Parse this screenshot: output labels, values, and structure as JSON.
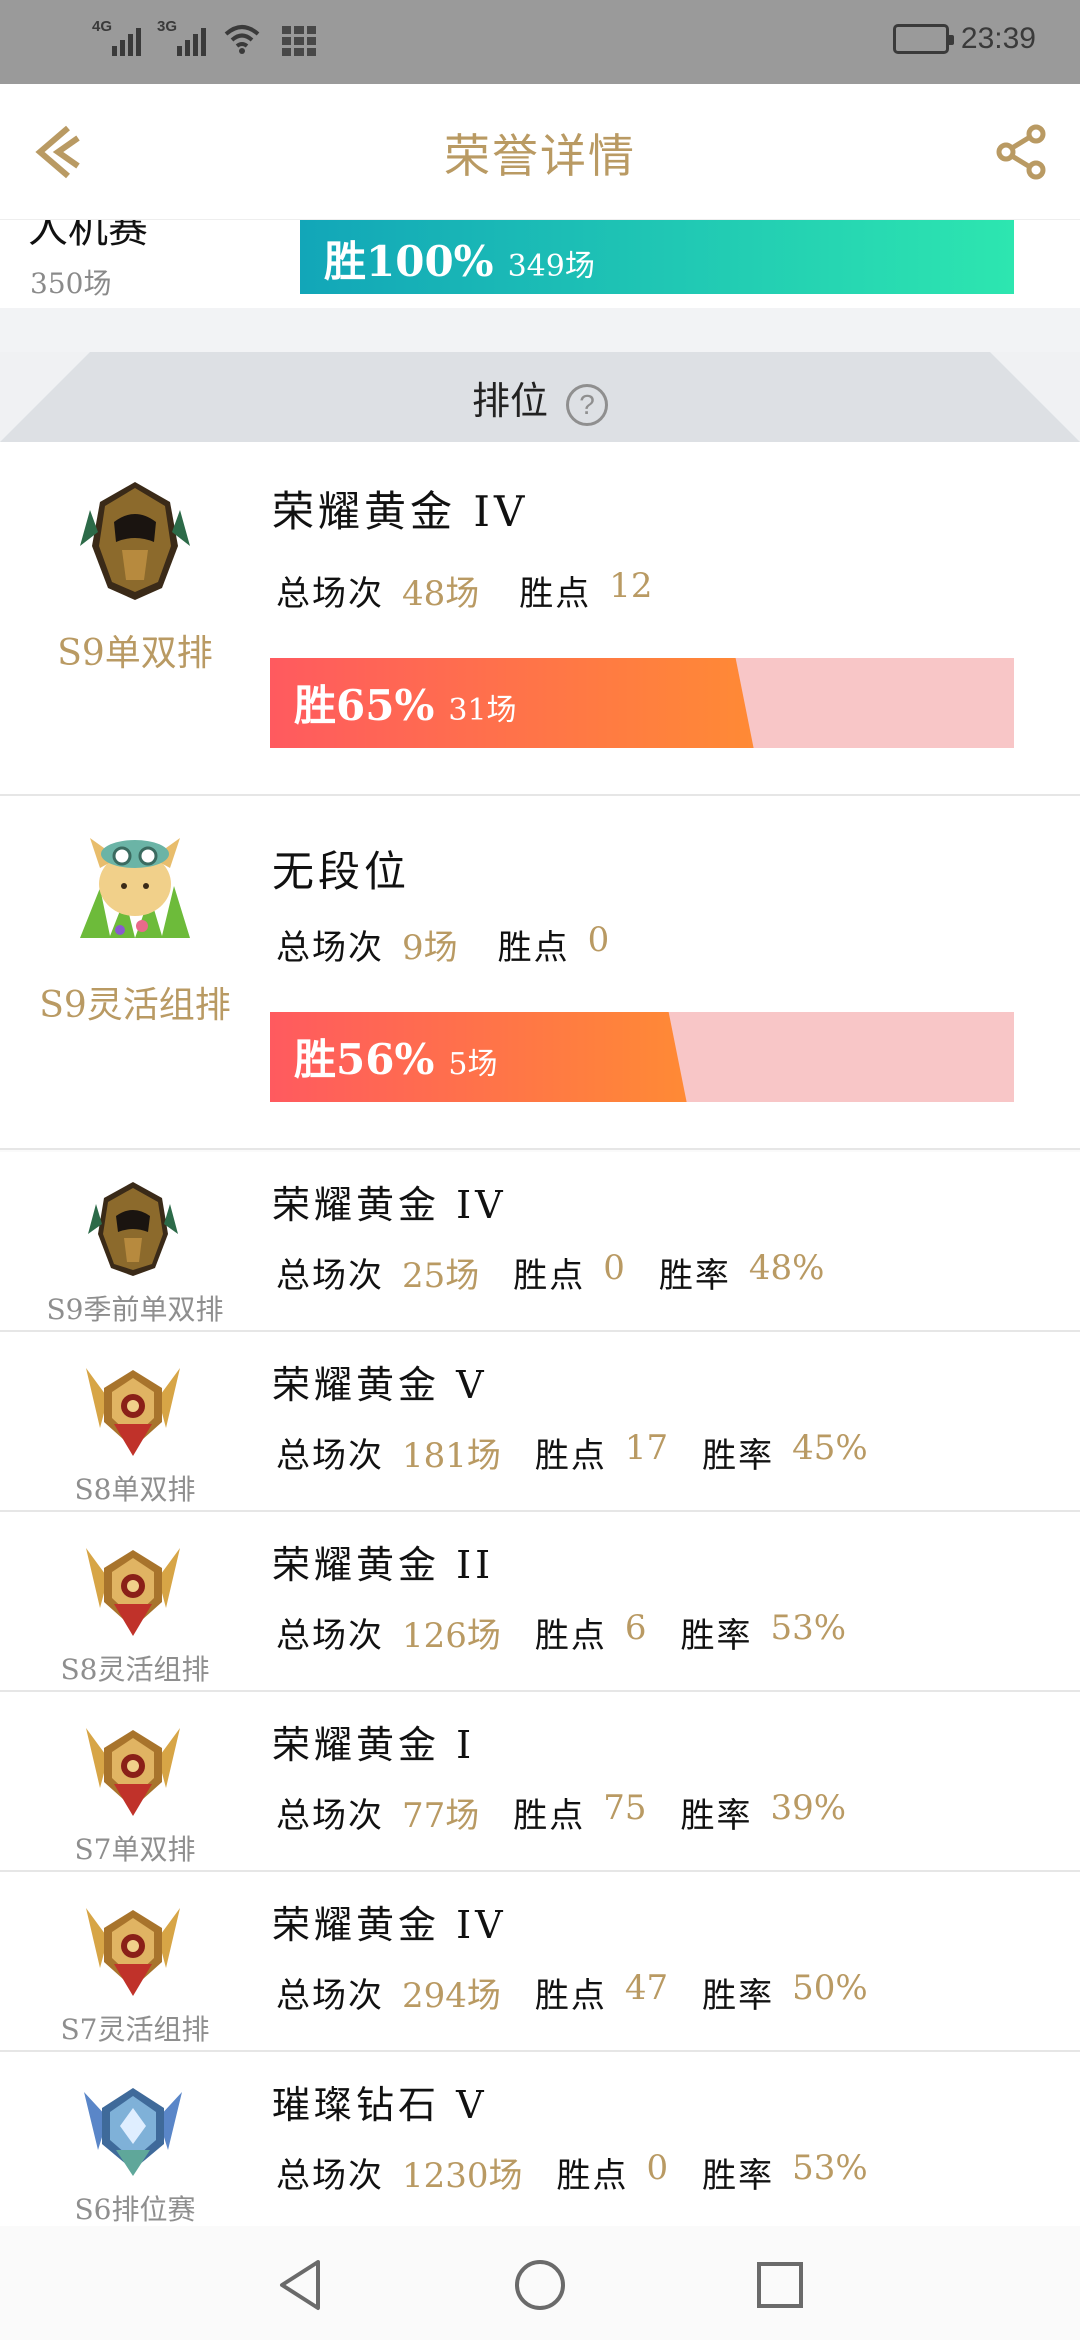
{
  "status_bar": {
    "signal1_label": "4G",
    "signal2_label": "3G",
    "time": "23:39"
  },
  "header": {
    "title": "荣誉详情"
  },
  "top_partial": {
    "name": "人机赛",
    "count": "350场",
    "win_label": "胜100%",
    "win_games": "349场",
    "win_rate": 1.0
  },
  "section": {
    "title": "排位",
    "help_glyph": "?"
  },
  "labels": {
    "total": "总场次",
    "points": "胜点",
    "rate": "胜率"
  },
  "big_entries": [
    {
      "season": "S9单双排",
      "rank": "荣耀黄金 IV",
      "total": "48场",
      "points": "12",
      "win_label": "胜65%",
      "win_games": "31场",
      "win_rate": 0.65,
      "icon": "gold-helmet-icon"
    },
    {
      "season": "S9灵活组排",
      "rank": "无段位",
      "total": "9场",
      "points": "0",
      "win_label": "胜56%",
      "win_games": "5场",
      "win_rate": 0.56,
      "icon": "teemo-avatar-icon"
    }
  ],
  "small_entries": [
    {
      "season": "S9季前单双排",
      "rank": "荣耀黄金 IV",
      "total": "25场",
      "points": "0",
      "rate": "48%",
      "icon": "gold-helmet-icon"
    },
    {
      "season": "S8单双排",
      "rank": "荣耀黄金 V",
      "total": "181场",
      "points": "17",
      "rate": "45%",
      "icon": "gold-crest-icon"
    },
    {
      "season": "S8灵活组排",
      "rank": "荣耀黄金 II",
      "total": "126场",
      "points": "6",
      "rate": "53%",
      "icon": "gold-crest-icon"
    },
    {
      "season": "S7单双排",
      "rank": "荣耀黄金 I",
      "total": "77场",
      "points": "75",
      "rate": "39%",
      "icon": "gold-crest-icon"
    },
    {
      "season": "S7灵活组排",
      "rank": "荣耀黄金 IV",
      "total": "294场",
      "points": "47",
      "rate": "50%",
      "icon": "gold-crest-icon"
    },
    {
      "season": "S6排位赛",
      "rank": "璀璨钻石 V",
      "total": "1230场",
      "points": "0",
      "rate": "53%",
      "icon": "diamond-crest-icon"
    }
  ],
  "colors": {
    "gold_accent": "#b99a63",
    "teal_start": "#12a6b8",
    "teal_end": "#2de6b0",
    "red_start": "#ff5a5f",
    "orange_end": "#ff8a35",
    "pink_track": "#f8c6c7"
  }
}
